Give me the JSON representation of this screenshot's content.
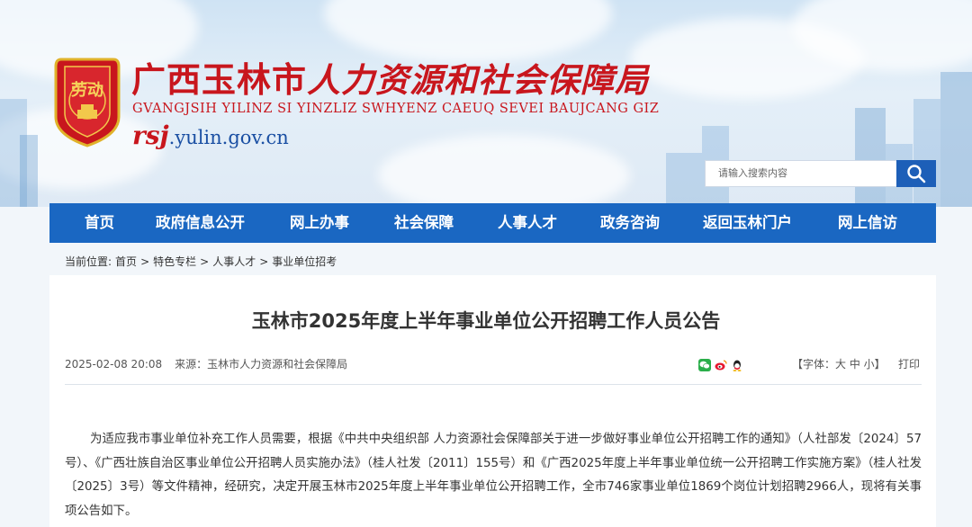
{
  "header": {
    "title_part1": "广西玉林市",
    "title_part2": "人力资源和社会保障局",
    "subtitle": "GVANGJSIH YILINZ SI YINZLIZ SWHYENZ CAEUQ SEVEI BAUJCANG GIZ",
    "domain_prefix": "rsj",
    "domain_rest": ".yulin.gov.cn",
    "emblem_text": "劳动"
  },
  "search": {
    "placeholder": "请输入搜索内容"
  },
  "nav": {
    "items": [
      "首页",
      "政府信息公开",
      "网上办事",
      "社会保障",
      "人事人才",
      "政务咨询",
      "返回玉林门户",
      "网上信访"
    ]
  },
  "breadcrumb": {
    "prefix": "当前位置:",
    "items": [
      "首页",
      "特色专栏",
      "人事人才",
      "事业单位招考"
    ],
    "separator": ">"
  },
  "article": {
    "title": "玉林市2025年度上半年事业单位公开招聘工作人员公告",
    "date": "2025-02-08 20:08",
    "source": "来源：玉林市人力资源和社会保障局",
    "font_label": "【字体：大 中 小】",
    "print_label": "打印",
    "paragraph": "为适应我市事业单位补充工作人员需要，根据《中共中央组织部 人力资源社会保障部关于进一步做好事业单位公开招聘工作的通知》（人社部发〔2024〕57号）、《广西壮族自治区事业单位公开招聘人员实施办法》（桂人社发〔2011〕155号）和《广西2025年度上半年事业单位统一公开招聘工作实施方案》（桂人社发〔2025〕3号）等文件精神，经研究，决定开展玉林市2025年度上半年事业单位公开招聘工作，全市746家事业单位1869个岗位计划招聘2966人，现将有关事项公告如下。"
  },
  "colors": {
    "brand_red": "#c8161d",
    "nav_blue": "#1a67c2",
    "search_blue": "#1d5fb8"
  }
}
